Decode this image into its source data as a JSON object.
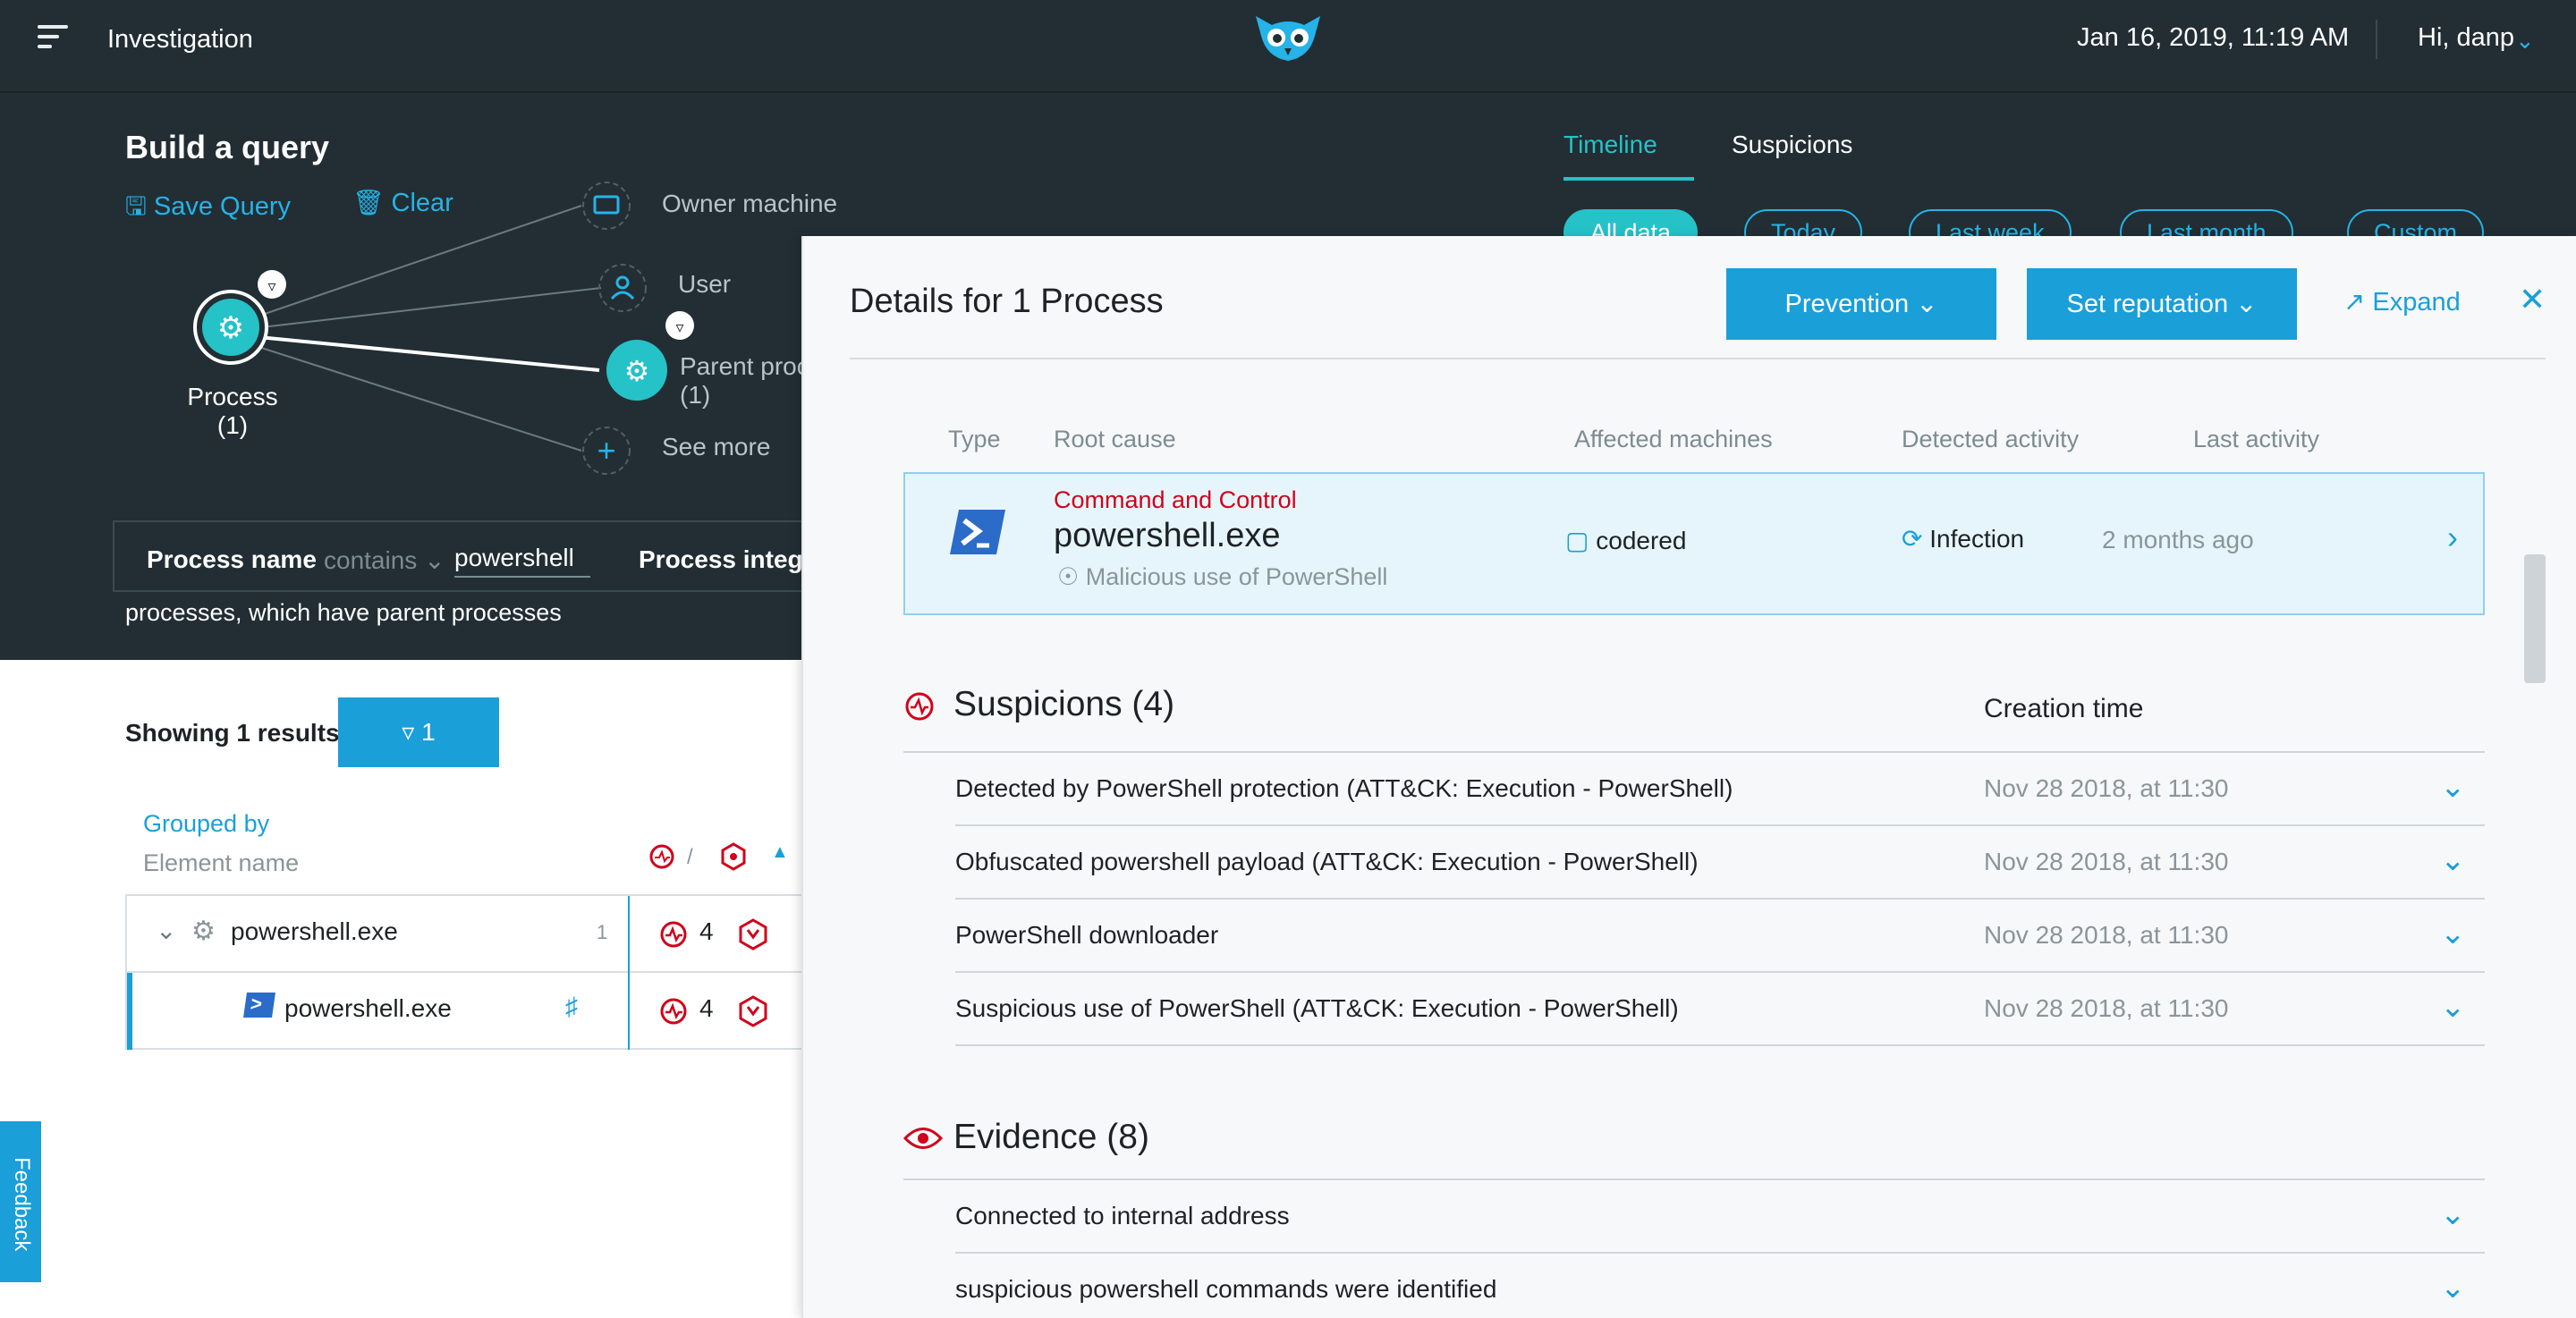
{
  "topbar": {
    "title": "Investigation",
    "datetime": "Jan 16, 2019, 11:19 AM",
    "user": "Hi, danp"
  },
  "query": {
    "title": "Build a query",
    "save_label": "Save Query",
    "clear_label": "Clear",
    "nodes": {
      "process": "Process",
      "process_count": "(1)",
      "owner_machine": "Owner machine",
      "user": "User",
      "parent_process": "Parent proc",
      "parent_count": "(1)",
      "see_more": "See more"
    },
    "filter": {
      "field": "Process name",
      "operator": "contains",
      "value": "powershell",
      "field2": "Process integri"
    },
    "description": "processes, which have parent processes"
  },
  "tabs": {
    "timeline": "Timeline",
    "suspicions": "Suspicions"
  },
  "time_filters": [
    "All data",
    "Today",
    "Last week",
    "Last month",
    "Custom"
  ],
  "results": {
    "showing": "Showing 1 results",
    "filter_count": "1",
    "grouped_by": "Grouped by",
    "grouped_sub": "Element name",
    "rows": [
      {
        "name": "powershell.exe",
        "count": "1",
        "suspicions": "4"
      },
      {
        "name": "powershell.exe",
        "suspicions": "4"
      }
    ]
  },
  "feedback": "Feedback",
  "details": {
    "title": "Details for 1 Process",
    "prevention": "Prevention",
    "set_reputation": "Set reputation",
    "expand": "Expand",
    "columns": {
      "type": "Type",
      "root_cause": "Root cause",
      "affected": "Affected machines",
      "detected": "Detected activity",
      "last": "Last activity"
    },
    "root": {
      "category": "Command and Control",
      "name": "powershell.exe",
      "subtitle": "Malicious use of PowerShell",
      "machine": "codered",
      "activity": "Infection",
      "last_activity": "2 months ago"
    },
    "suspicions": {
      "title": "Suspicions (4)",
      "creation_time": "Creation time",
      "items": [
        {
          "text": "Detected by PowerShell protection (ATT&CK: Execution - PowerShell)",
          "time": "Nov 28 2018, at 11:30"
        },
        {
          "text": "Obfuscated powershell payload (ATT&CK: Execution - PowerShell)",
          "time": "Nov 28 2018, at 11:30"
        },
        {
          "text": "PowerShell downloader",
          "time": "Nov 28 2018, at 11:30"
        },
        {
          "text": "Suspicious use of PowerShell (ATT&CK: Execution - PowerShell)",
          "time": "Nov 28 2018, at 11:30"
        }
      ]
    },
    "evidence": {
      "title": "Evidence (8)",
      "items": [
        {
          "text": "Connected to internal address"
        },
        {
          "text": "suspicious powershell commands were identified"
        }
      ]
    }
  },
  "colors": {
    "dark_bg": "#222e33",
    "accent_blue": "#1a9fd8",
    "teal": "#25c2c8",
    "danger_red": "#d0021b"
  }
}
